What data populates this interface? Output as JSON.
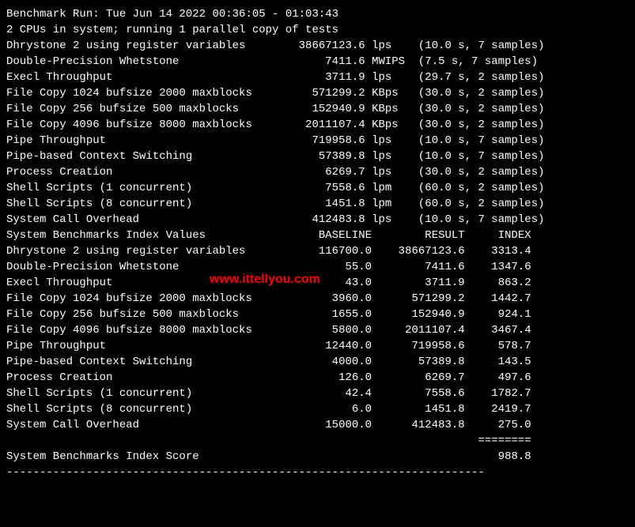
{
  "header": {
    "run_line": "Benchmark Run: Tue Jun 14 2022 00:36:05 - 01:03:43",
    "cpu_line": "2 CPUs in system; running 1 parallel copy of tests"
  },
  "watermark": "www.ittellyou.com",
  "results": [
    {
      "name": "Dhrystone 2 using register variables",
      "value": "38667123.6",
      "unit": "lps",
      "timing": "(10.0 s, 7 samples)"
    },
    {
      "name": "Double-Precision Whetstone",
      "value": "7411.6",
      "unit": "MWIPS",
      "timing": "(7.5 s, 7 samples)"
    },
    {
      "name": "Execl Throughput",
      "value": "3711.9",
      "unit": "lps",
      "timing": "(29.7 s, 2 samples)"
    },
    {
      "name": "File Copy 1024 bufsize 2000 maxblocks",
      "value": "571299.2",
      "unit": "KBps",
      "timing": "(30.0 s, 2 samples)"
    },
    {
      "name": "File Copy 256 bufsize 500 maxblocks",
      "value": "152940.9",
      "unit": "KBps",
      "timing": "(30.0 s, 2 samples)"
    },
    {
      "name": "File Copy 4096 bufsize 8000 maxblocks",
      "value": "2011107.4",
      "unit": "KBps",
      "timing": "(30.0 s, 2 samples)"
    },
    {
      "name": "Pipe Throughput",
      "value": "719958.6",
      "unit": "lps",
      "timing": "(10.0 s, 7 samples)"
    },
    {
      "name": "Pipe-based Context Switching",
      "value": "57389.8",
      "unit": "lps",
      "timing": "(10.0 s, 7 samples)"
    },
    {
      "name": "Process Creation",
      "value": "6269.7",
      "unit": "lps",
      "timing": "(30.0 s, 2 samples)"
    },
    {
      "name": "Shell Scripts (1 concurrent)",
      "value": "7558.6",
      "unit": "lpm",
      "timing": "(60.0 s, 2 samples)"
    },
    {
      "name": "Shell Scripts (8 concurrent)",
      "value": "1451.8",
      "unit": "lpm",
      "timing": "(60.0 s, 2 samples)"
    },
    {
      "name": "System Call Overhead",
      "value": "412483.8",
      "unit": "lps",
      "timing": "(10.0 s, 7 samples)"
    }
  ],
  "index_header": {
    "title": "System Benchmarks Index Values",
    "col1": "BASELINE",
    "col2": "RESULT",
    "col3": "INDEX"
  },
  "index": [
    {
      "name": "Dhrystone 2 using register variables",
      "baseline": "116700.0",
      "result": "38667123.6",
      "index": "3313.4"
    },
    {
      "name": "Double-Precision Whetstone",
      "baseline": "55.0",
      "result": "7411.6",
      "index": "1347.6"
    },
    {
      "name": "Execl Throughput",
      "baseline": "43.0",
      "result": "3711.9",
      "index": "863.2"
    },
    {
      "name": "File Copy 1024 bufsize 2000 maxblocks",
      "baseline": "3960.0",
      "result": "571299.2",
      "index": "1442.7"
    },
    {
      "name": "File Copy 256 bufsize 500 maxblocks",
      "baseline": "1655.0",
      "result": "152940.9",
      "index": "924.1"
    },
    {
      "name": "File Copy 4096 bufsize 8000 maxblocks",
      "baseline": "5800.0",
      "result": "2011107.4",
      "index": "3467.4"
    },
    {
      "name": "Pipe Throughput",
      "baseline": "12440.0",
      "result": "719958.6",
      "index": "578.7"
    },
    {
      "name": "Pipe-based Context Switching",
      "baseline": "4000.0",
      "result": "57389.8",
      "index": "143.5"
    },
    {
      "name": "Process Creation",
      "baseline": "126.0",
      "result": "6269.7",
      "index": "497.6"
    },
    {
      "name": "Shell Scripts (1 concurrent)",
      "baseline": "42.4",
      "result": "7558.6",
      "index": "1782.7"
    },
    {
      "name": "Shell Scripts (8 concurrent)",
      "baseline": "6.0",
      "result": "1451.8",
      "index": "2419.7"
    },
    {
      "name": "System Call Overhead",
      "baseline": "15000.0",
      "result": "412483.8",
      "index": "275.0"
    }
  ],
  "score": {
    "label": "System Benchmarks Index Score",
    "value": "988.8"
  },
  "divider_eq": "========",
  "divider_dash": "------------------------------------------------------------------------"
}
